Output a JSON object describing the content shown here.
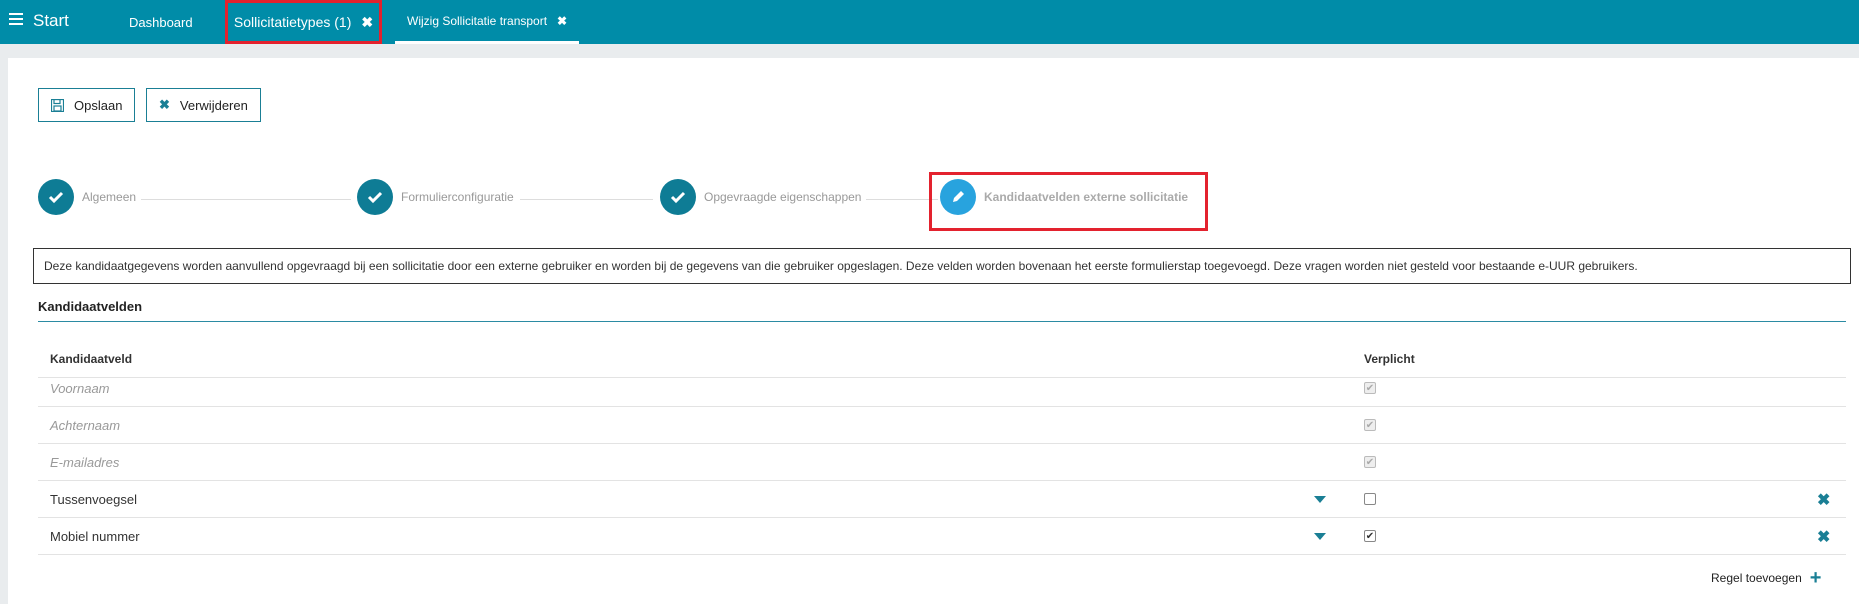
{
  "topbar": {
    "start_label": "Start",
    "tabs": [
      {
        "label": "Dashboard"
      },
      {
        "label": "Sollicitatietypes (1)",
        "close": "✖"
      },
      {
        "label": "Wijzig Sollicitatie transport",
        "close": "✖"
      }
    ]
  },
  "toolbar": {
    "save_label": "Opslaan",
    "delete_label": "Verwijderen"
  },
  "stepper": {
    "steps": [
      {
        "label": "Algemeen",
        "state": "done"
      },
      {
        "label": "Formulierconfiguratie",
        "state": "done"
      },
      {
        "label": "Opgevraagde eigenschappen",
        "state": "done"
      },
      {
        "label": "Kandidaatvelden externe sollicitatie",
        "state": "active"
      }
    ]
  },
  "info_text": "Deze kandidaatgegevens worden aanvullend opgevraagd bij een sollicitatie door een externe gebruiker en worden bij de gegevens van die gebruiker opgeslagen. Deze velden worden bovenaan het eerste formulierstap toegevoegd. Deze vragen worden niet gesteld voor bestaande e-UUR gebruikers.",
  "section": {
    "title": "Kandidaatvelden"
  },
  "table": {
    "headers": {
      "field": "Kandidaatveld",
      "required": "Verplicht"
    },
    "rows": [
      {
        "field": "Voornaam",
        "required": true,
        "locked": true
      },
      {
        "field": "Achternaam",
        "required": true,
        "locked": true
      },
      {
        "field": "E-mailadres",
        "required": true,
        "locked": true
      },
      {
        "field": "Tussenvoegsel",
        "required": false,
        "locked": false
      },
      {
        "field": "Mobiel nummer",
        "required": true,
        "locked": false
      }
    ],
    "add_label": "Regel toevoegen"
  },
  "colors": {
    "topbar": "#008ca8",
    "step_done": "#0e7c95",
    "step_active": "#28a3de",
    "highlight": "#e3222e"
  }
}
